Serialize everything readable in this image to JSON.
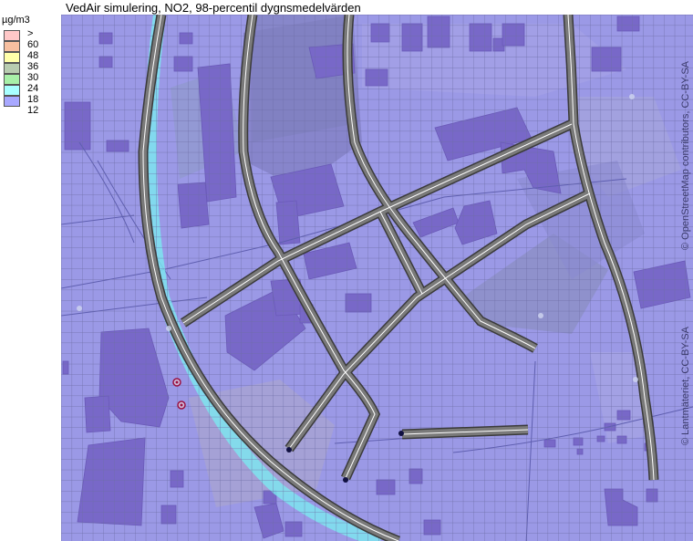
{
  "title": "VedAir simulering, NO2, 98-percentil dygnsmedelvärden",
  "legend": {
    "unit": "µg/m3",
    "items": [
      {
        "label": ">",
        "color": "#ffc8c8"
      },
      {
        "label": "60",
        "color": "#f8c0a0"
      },
      {
        "label": "48",
        "color": "#ffffaa"
      },
      {
        "label": "36",
        "color": "#b8ccb0"
      },
      {
        "label": "30",
        "color": "#a8f0a8"
      },
      {
        "label": "24",
        "color": "#a8ffff"
      },
      {
        "label": "18",
        "color": "#a8a8ff"
      },
      {
        "label": "12",
        "color": ""
      }
    ]
  },
  "credits": {
    "osm": "© OpenStreetMap contributors, CC-BY-SA",
    "lm": "© Lantmäteriet, CC-BY-SA"
  },
  "colors": {
    "background": "#9b99e6",
    "building": "#7868c8",
    "road": "#6a6a6a",
    "road_center": "#ffffff",
    "grid": "#6d6da5",
    "elevated": "#7ce8f0"
  }
}
